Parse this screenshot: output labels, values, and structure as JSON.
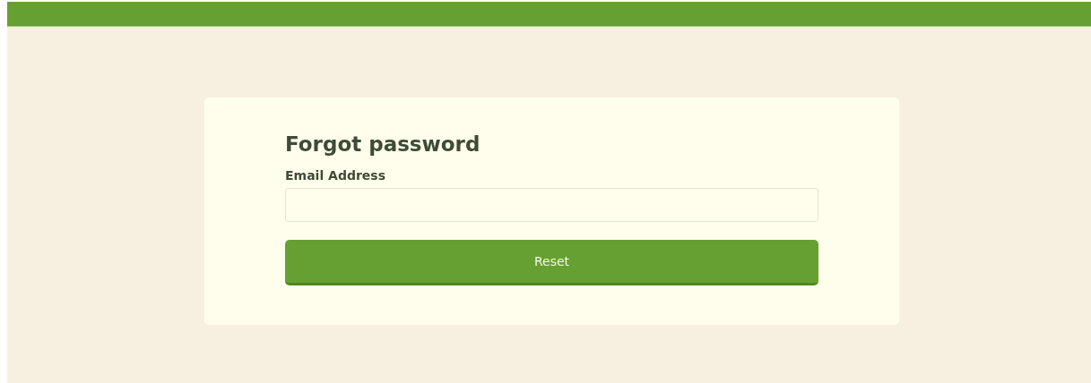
{
  "form": {
    "title": "Forgot password",
    "fields": [
      {
        "label": "Email Address"
      }
    ],
    "submit": "Reset"
  }
}
